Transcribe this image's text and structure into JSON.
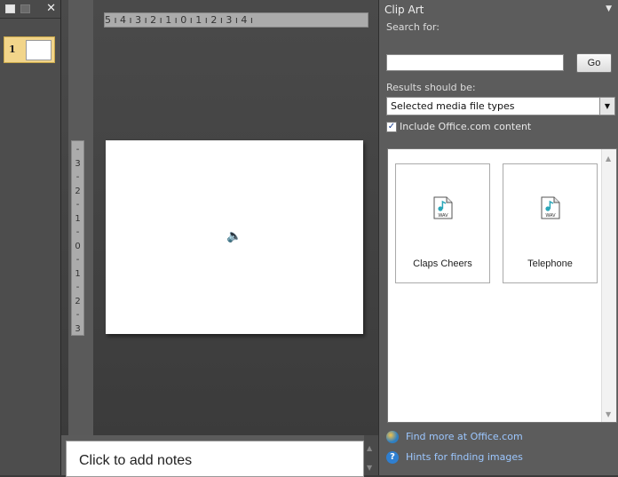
{
  "thumbnails": {
    "close_glyph": "✕",
    "slides": [
      {
        "number": "1"
      }
    ]
  },
  "editor": {
    "hruler_text": "5 ı 4 ı 3 ı 2 ı 1 ı 0 ı 1 ı 2 ı 3 ı 4 ı",
    "vruler_text": "- 3 - 2 - 1 - 0 - 1 - 2 - 3 -",
    "sound_glyph": "🔈"
  },
  "notes": {
    "placeholder": "Click to add notes"
  },
  "clipart": {
    "title": "Clip Art",
    "menu_glyph": "▼",
    "search_label": "Search for:",
    "search_value": "",
    "go_label": "Go",
    "results_label": "Results should be:",
    "media_selected": "Selected media file types",
    "include_checked": "✓",
    "include_label": "Include Office.com content",
    "results": [
      {
        "label": "Claps Cheers",
        "icon": "wav-file-icon"
      },
      {
        "label": "Telephone",
        "icon": "wav-file-icon"
      }
    ],
    "link_more": "Find more at Office.com",
    "link_hints": "Hints for finding images",
    "help_glyph": "?"
  }
}
